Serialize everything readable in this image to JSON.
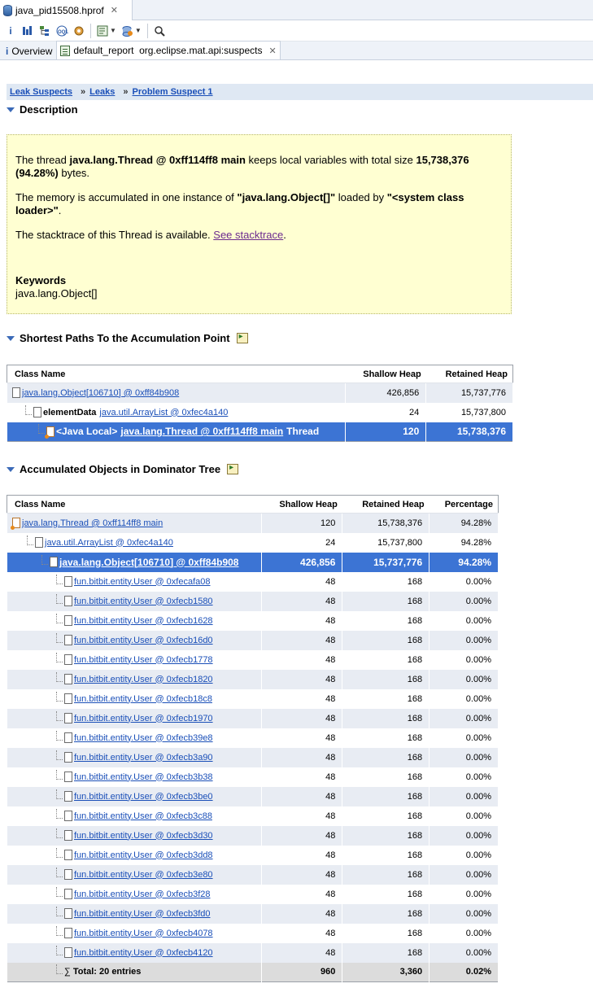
{
  "editor_tab": {
    "title": "java_pid15508.hprof"
  },
  "toolbar": {
    "buttons": [
      "info-icon",
      "histogram-icon",
      "dominator-tree-icon",
      "oql-icon",
      "gear-icon",
      "report-icon",
      "query-browser-icon",
      "search-icon"
    ]
  },
  "sub_tabs": [
    {
      "label": "Overview"
    },
    {
      "label": "default_report  org.eclipse.mat.api:suspects"
    }
  ],
  "breadcrumb": [
    "Leak Suspects",
    "Leaks",
    "Problem Suspect 1"
  ],
  "description": {
    "heading": "Description",
    "p1_pre": "The thread ",
    "p1_bold1": "java.lang.Thread @ 0xff114ff8 main",
    "p1_mid": " keeps local variables with total size ",
    "p1_bold2": "15,738,376 (94.28%)",
    "p1_post": " bytes.",
    "p2_pre": "The memory is accumulated in one instance of ",
    "p2_bold1": "\"java.lang.Object[]\"",
    "p2_mid": " loaded by ",
    "p2_bold2": "\"<system class loader>\"",
    "p2_post": ".",
    "p3_pre": "The stacktrace of this Thread is available. ",
    "p3_link": "See stacktrace",
    "p3_post": ".",
    "keywords_title": "Keywords",
    "keywords_value": "java.lang.Object[]"
  },
  "shortest_paths": {
    "heading": "Shortest Paths To the Accumulation Point",
    "columns": [
      "Class Name",
      "Shallow Heap",
      "Retained Heap"
    ],
    "rows": [
      {
        "prefix": "",
        "link": "java.lang.Object[106710] @ 0xff84b908",
        "suffix": "",
        "shallow": "426,856",
        "retained": "15,737,776"
      },
      {
        "prefix": "elementData",
        "link": "java.util.ArrayList @ 0xfec4a140",
        "suffix": "",
        "shallow": "24",
        "retained": "15,737,800"
      },
      {
        "prefix": "<Java Local>",
        "link": "java.lang.Thread @ 0xff114ff8 main",
        "suffix": "Thread",
        "shallow": "120",
        "retained": "15,738,376"
      }
    ]
  },
  "dominator": {
    "heading": "Accumulated Objects in Dominator Tree",
    "columns": [
      "Class Name",
      "Shallow Heap",
      "Retained Heap",
      "Percentage"
    ],
    "rows": [
      {
        "name": "java.lang.Thread @ 0xff114ff8 main",
        "shallow": "120",
        "retained": "15,738,376",
        "pct": "94.28%"
      },
      {
        "name": "java.util.ArrayList @ 0xfec4a140",
        "shallow": "24",
        "retained": "15,737,800",
        "pct": "94.28%"
      },
      {
        "name": "java.lang.Object[106710] @ 0xff84b908",
        "shallow": "426,856",
        "retained": "15,737,776",
        "pct": "94.28%"
      },
      {
        "name": "fun.bitbit.entity.User @ 0xfecafa08",
        "shallow": "48",
        "retained": "168",
        "pct": "0.00%"
      },
      {
        "name": "fun.bitbit.entity.User @ 0xfecb1580",
        "shallow": "48",
        "retained": "168",
        "pct": "0.00%"
      },
      {
        "name": "fun.bitbit.entity.User @ 0xfecb1628",
        "shallow": "48",
        "retained": "168",
        "pct": "0.00%"
      },
      {
        "name": "fun.bitbit.entity.User @ 0xfecb16d0",
        "shallow": "48",
        "retained": "168",
        "pct": "0.00%"
      },
      {
        "name": "fun.bitbit.entity.User @ 0xfecb1778",
        "shallow": "48",
        "retained": "168",
        "pct": "0.00%"
      },
      {
        "name": "fun.bitbit.entity.User @ 0xfecb1820",
        "shallow": "48",
        "retained": "168",
        "pct": "0.00%"
      },
      {
        "name": "fun.bitbit.entity.User @ 0xfecb18c8",
        "shallow": "48",
        "retained": "168",
        "pct": "0.00%"
      },
      {
        "name": "fun.bitbit.entity.User @ 0xfecb1970",
        "shallow": "48",
        "retained": "168",
        "pct": "0.00%"
      },
      {
        "name": "fun.bitbit.entity.User @ 0xfecb39e8",
        "shallow": "48",
        "retained": "168",
        "pct": "0.00%"
      },
      {
        "name": "fun.bitbit.entity.User @ 0xfecb3a90",
        "shallow": "48",
        "retained": "168",
        "pct": "0.00%"
      },
      {
        "name": "fun.bitbit.entity.User @ 0xfecb3b38",
        "shallow": "48",
        "retained": "168",
        "pct": "0.00%"
      },
      {
        "name": "fun.bitbit.entity.User @ 0xfecb3be0",
        "shallow": "48",
        "retained": "168",
        "pct": "0.00%"
      },
      {
        "name": "fun.bitbit.entity.User @ 0xfecb3c88",
        "shallow": "48",
        "retained": "168",
        "pct": "0.00%"
      },
      {
        "name": "fun.bitbit.entity.User @ 0xfecb3d30",
        "shallow": "48",
        "retained": "168",
        "pct": "0.00%"
      },
      {
        "name": "fun.bitbit.entity.User @ 0xfecb3dd8",
        "shallow": "48",
        "retained": "168",
        "pct": "0.00%"
      },
      {
        "name": "fun.bitbit.entity.User @ 0xfecb3e80",
        "shallow": "48",
        "retained": "168",
        "pct": "0.00%"
      },
      {
        "name": "fun.bitbit.entity.User @ 0xfecb3f28",
        "shallow": "48",
        "retained": "168",
        "pct": "0.00%"
      },
      {
        "name": "fun.bitbit.entity.User @ 0xfecb3fd0",
        "shallow": "48",
        "retained": "168",
        "pct": "0.00%"
      },
      {
        "name": "fun.bitbit.entity.User @ 0xfecb4078",
        "shallow": "48",
        "retained": "168",
        "pct": "0.00%"
      },
      {
        "name": "fun.bitbit.entity.User @ 0xfecb4120",
        "shallow": "48",
        "retained": "168",
        "pct": "0.00%"
      }
    ],
    "total": {
      "label": "Total: 20 entries",
      "shallow": "960",
      "retained": "3,360",
      "pct": "0.02%"
    }
  }
}
